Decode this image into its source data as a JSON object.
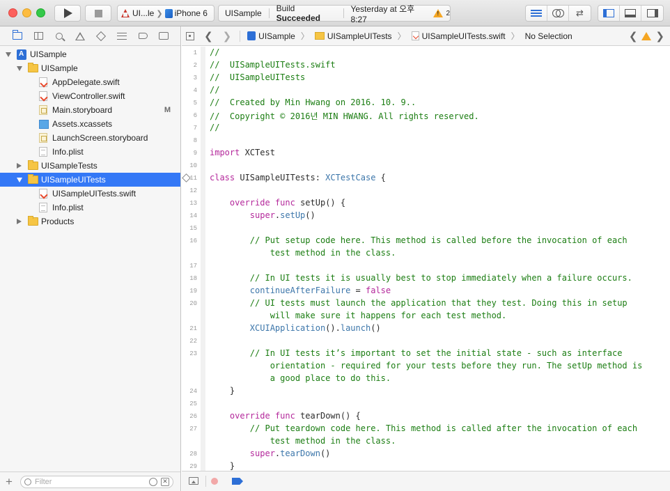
{
  "toolbar": {
    "scheme_target": "UI...le",
    "scheme_device": "iPhone 6",
    "activity_project": "UISample",
    "activity_status_prefix": "Build",
    "activity_status": "Succeeded",
    "activity_time": "Yesterday at 오후 8:27",
    "warning_count": "2"
  },
  "navigator": {
    "tree": [
      {
        "label": "UISample",
        "icon": "project-icon",
        "depth": 0,
        "disclosure": "open",
        "badge": "",
        "selected": false
      },
      {
        "label": "UISample",
        "icon": "folder-icon",
        "depth": 1,
        "disclosure": "open",
        "badge": "",
        "selected": false
      },
      {
        "label": "AppDelegate.swift",
        "icon": "swift-file-icon",
        "depth": 2,
        "disclosure": "",
        "badge": "",
        "selected": false
      },
      {
        "label": "ViewController.swift",
        "icon": "swift-file-icon",
        "depth": 2,
        "disclosure": "",
        "badge": "",
        "selected": false
      },
      {
        "label": "Main.storyboard",
        "icon": "storyboard-icon",
        "depth": 2,
        "disclosure": "",
        "badge": "M",
        "selected": false
      },
      {
        "label": "Assets.xcassets",
        "icon": "asset-catalog-icon",
        "depth": 2,
        "disclosure": "",
        "badge": "",
        "selected": false
      },
      {
        "label": "LaunchScreen.storyboard",
        "icon": "storyboard-icon",
        "depth": 2,
        "disclosure": "",
        "badge": "",
        "selected": false
      },
      {
        "label": "Info.plist",
        "icon": "plist-file-icon",
        "depth": 2,
        "disclosure": "",
        "badge": "",
        "selected": false
      },
      {
        "label": "UISampleTests",
        "icon": "folder-icon",
        "depth": 1,
        "disclosure": "closed",
        "badge": "",
        "selected": false
      },
      {
        "label": "UISampleUITests",
        "icon": "folder-icon",
        "depth": 1,
        "disclosure": "open",
        "badge": "",
        "selected": true
      },
      {
        "label": "UISampleUITests.swift",
        "icon": "swift-file-icon",
        "depth": 2,
        "disclosure": "",
        "badge": "",
        "selected": false
      },
      {
        "label": "Info.plist",
        "icon": "plist-file-icon",
        "depth": 2,
        "disclosure": "",
        "badge": "",
        "selected": false
      },
      {
        "label": "Products",
        "icon": "folder-icon",
        "depth": 1,
        "disclosure": "closed",
        "badge": "",
        "selected": false
      }
    ],
    "filter_placeholder": "Filter"
  },
  "jumpbar": {
    "crumbs": [
      "UISample",
      "UISampleUITests",
      "UISampleUITests.swift",
      "No Selection"
    ]
  },
  "editor": {
    "lines": [
      {
        "n": "1",
        "segs": [
          [
            "cm",
            "//"
          ]
        ]
      },
      {
        "n": "2",
        "segs": [
          [
            "cm",
            "//  UISampleUITests.swift"
          ]
        ]
      },
      {
        "n": "3",
        "segs": [
          [
            "cm",
            "//  UISampleUITests"
          ]
        ]
      },
      {
        "n": "4",
        "segs": [
          [
            "cm",
            "//"
          ]
        ]
      },
      {
        "n": "5",
        "segs": [
          [
            "cm",
            "//  Created by Min Hwang on 2016. 10. 9.."
          ]
        ]
      },
      {
        "n": "6",
        "segs": [
          [
            "cm",
            "//  Copyright © 2016년 MIN HWANG. All rights reserved."
          ]
        ]
      },
      {
        "n": "7",
        "segs": [
          [
            "cm",
            "//"
          ]
        ]
      },
      {
        "n": "8",
        "segs": []
      },
      {
        "n": "9",
        "segs": [
          [
            "kw",
            "import"
          ],
          [
            "nm",
            " XCTest"
          ]
        ]
      },
      {
        "n": "10",
        "segs": []
      },
      {
        "n": "11",
        "segs": [
          [
            "kw",
            "class"
          ],
          [
            "nm",
            " UISampleUITests: "
          ],
          [
            "ty",
            "XCTestCase"
          ],
          [
            "nm",
            " {"
          ]
        ],
        "marker": true
      },
      {
        "n": "12",
        "segs": []
      },
      {
        "n": "13",
        "segs": [
          [
            "nm",
            "    "
          ],
          [
            "kw",
            "override"
          ],
          [
            "nm",
            " "
          ],
          [
            "kw",
            "func"
          ],
          [
            "nm",
            " setUp() {"
          ]
        ]
      },
      {
        "n": "14",
        "segs": [
          [
            "nm",
            "        "
          ],
          [
            "kw",
            "super"
          ],
          [
            "nm",
            "."
          ],
          [
            "fn",
            "setUp"
          ],
          [
            "nm",
            "()"
          ]
        ]
      },
      {
        "n": "15",
        "segs": []
      },
      {
        "n": "16",
        "segs": [
          [
            "cm",
            "        // Put setup code here. This method is called before the invocation of each"
          ]
        ]
      },
      {
        "n": "",
        "segs": [
          [
            "cm",
            "            test method in the class."
          ]
        ]
      },
      {
        "n": "17",
        "segs": []
      },
      {
        "n": "18",
        "segs": [
          [
            "cm",
            "        // In UI tests it is usually best to stop immediately when a failure occurs."
          ]
        ]
      },
      {
        "n": "19",
        "segs": [
          [
            "nm",
            "        "
          ],
          [
            "fn",
            "continueAfterFailure"
          ],
          [
            "nm",
            " = "
          ],
          [
            "kw",
            "false"
          ]
        ]
      },
      {
        "n": "20",
        "segs": [
          [
            "cm",
            "        // UI tests must launch the application that they test. Doing this in setup"
          ]
        ]
      },
      {
        "n": "",
        "segs": [
          [
            "cm",
            "            will make sure it happens for each test method."
          ]
        ]
      },
      {
        "n": "21",
        "segs": [
          [
            "nm",
            "        "
          ],
          [
            "ty",
            "XCUIApplication"
          ],
          [
            "nm",
            "()."
          ],
          [
            "fn",
            "launch"
          ],
          [
            "nm",
            "()"
          ]
        ]
      },
      {
        "n": "22",
        "segs": []
      },
      {
        "n": "23",
        "segs": [
          [
            "cm",
            "        // In UI tests it’s important to set the initial state - such as interface"
          ]
        ]
      },
      {
        "n": "",
        "segs": [
          [
            "cm",
            "            orientation - required for your tests before they run. The setUp method is"
          ]
        ]
      },
      {
        "n": "",
        "segs": [
          [
            "cm",
            "            a good place to do this."
          ]
        ]
      },
      {
        "n": "24",
        "segs": [
          [
            "nm",
            "    }"
          ]
        ]
      },
      {
        "n": "25",
        "segs": []
      },
      {
        "n": "26",
        "segs": [
          [
            "nm",
            "    "
          ],
          [
            "kw",
            "override"
          ],
          [
            "nm",
            " "
          ],
          [
            "kw",
            "func"
          ],
          [
            "nm",
            " tearDown() {"
          ]
        ]
      },
      {
        "n": "27",
        "segs": [
          [
            "cm",
            "        // Put teardown code here. This method is called after the invocation of each"
          ]
        ]
      },
      {
        "n": "",
        "segs": [
          [
            "cm",
            "            test method in the class."
          ]
        ]
      },
      {
        "n": "28",
        "segs": [
          [
            "nm",
            "        "
          ],
          [
            "kw",
            "super"
          ],
          [
            "nm",
            "."
          ],
          [
            "fn",
            "tearDown"
          ],
          [
            "nm",
            "()"
          ]
        ]
      },
      {
        "n": "29",
        "segs": [
          [
            "nm",
            "    }"
          ]
        ]
      }
    ]
  },
  "colors": {
    "selection": "#3478f6",
    "comment": "#1b7d12",
    "keyword": "#b4289b",
    "type": "#3c76aa",
    "warning": "#f5a623"
  }
}
